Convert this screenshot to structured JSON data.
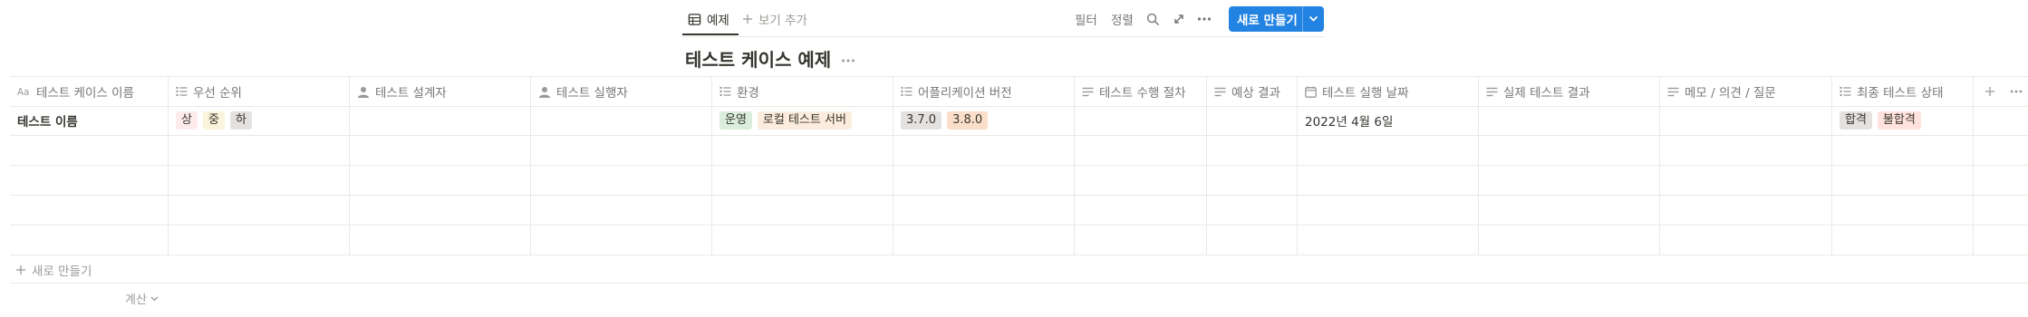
{
  "view_bar": {
    "tab_label": "예제",
    "add_view_label": "보기 추가",
    "filter_label": "필터",
    "sort_label": "정렬",
    "new_button_label": "새로 만들기"
  },
  "title": "테스트 케이스 예제",
  "columns": [
    {
      "label": "테스트 케이스 이름",
      "icon": "title-aa-icon"
    },
    {
      "label": "우선 순위",
      "icon": "multi-select-icon"
    },
    {
      "label": "테스트 설계자",
      "icon": "person-icon"
    },
    {
      "label": "테스트 실행자",
      "icon": "person-icon"
    },
    {
      "label": "환경",
      "icon": "multi-select-icon"
    },
    {
      "label": "어플리케이션 버전",
      "icon": "multi-select-icon"
    },
    {
      "label": "테스트 수행 절차",
      "icon": "text-icon"
    },
    {
      "label": "예상 결과",
      "icon": "text-icon"
    },
    {
      "label": "테스트 실행 날짜",
      "icon": "calendar-icon"
    },
    {
      "label": "실제 테스트 결과",
      "icon": "text-icon"
    },
    {
      "label": "메모 / 의견 / 질문",
      "icon": "text-icon"
    },
    {
      "label": "최종 테스트 상태",
      "icon": "multi-select-icon"
    }
  ],
  "row": {
    "name": "테스트 이름",
    "priority_tags": [
      {
        "label": "상",
        "color": "#fdebec"
      },
      {
        "label": "중",
        "color": "#fbf3db"
      },
      {
        "label": "하",
        "color": "#e3e2e0"
      }
    ],
    "environment_tags": [
      {
        "label": "운영",
        "color": "#dbeddb"
      },
      {
        "label": "로컬 테스트 서버",
        "color": "#fbecdd"
      }
    ],
    "version_tags": [
      {
        "label": "3.7.0",
        "color": "#e3e2e0"
      },
      {
        "label": "3.8.0",
        "color": "#fadec9"
      }
    ],
    "date": "2022년 4월 6일",
    "status_tags": [
      {
        "label": "합격",
        "color": "#e3e2e0"
      },
      {
        "label": "불합격",
        "color": "#ffe2dd"
      }
    ]
  },
  "footer": {
    "new_label": "새로 만들기",
    "calc_label": "계산"
  },
  "colors": {
    "accent": "#2383e2",
    "border": "#e9e9e7",
    "muted_text": "#787774"
  }
}
